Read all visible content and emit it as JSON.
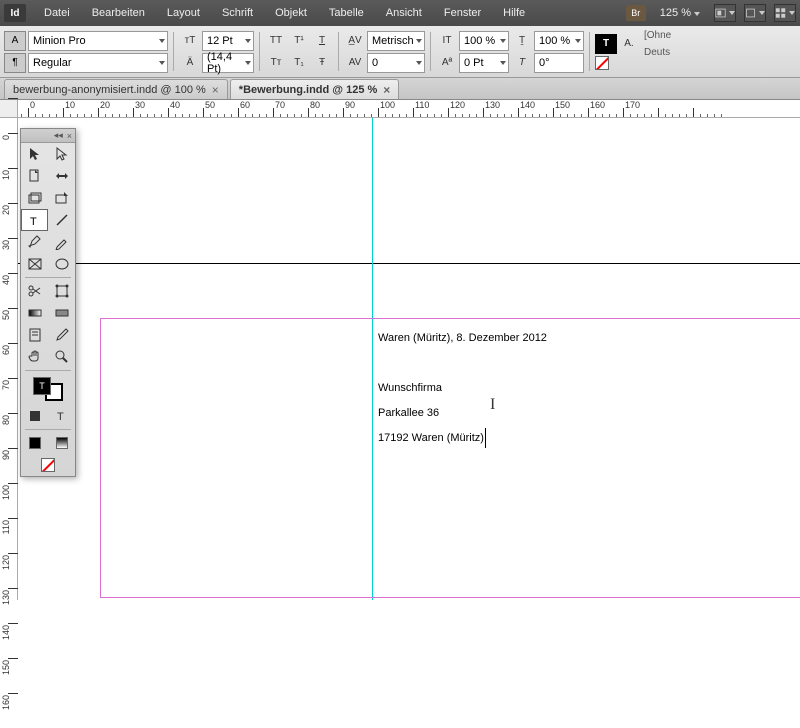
{
  "app_icon": "Id",
  "menu": [
    "Datei",
    "Bearbeiten",
    "Layout",
    "Schrift",
    "Objekt",
    "Tabelle",
    "Ansicht",
    "Fenster",
    "Hilfe"
  ],
  "br_icon": "Br",
  "zoom": "125 %",
  "control": {
    "para_icon": "A",
    "font": "Minion Pro",
    "style": "Regular",
    "size_icon": "T",
    "size": "12 Pt",
    "leading_icon": "A",
    "leading": "(14,4 Pt)",
    "caps": [
      "TT",
      "T¹",
      "T"
    ],
    "caps2": [
      "Tт",
      "T₁",
      "Ŧ"
    ],
    "kern_icon": "AV",
    "kern_mode": "Metrisch",
    "track_icon": "AV",
    "track": "0",
    "vscale_icon": "IT",
    "vscale": "100 %",
    "hscale_icon": "T",
    "hscale": "100 %",
    "baseline_icon": "Aª",
    "baseline": "0 Pt",
    "skew_icon": "T",
    "skew": "0°",
    "fill_icon": "T",
    "lang_icon": "A.",
    "ohne": "[Ohne",
    "lang": "Deuts"
  },
  "tabs": [
    {
      "label": "bewerbung-anonymisiert.indd @ 100 %",
      "active": false
    },
    {
      "label": "*Bewerbung.indd @ 125 %",
      "active": true
    }
  ],
  "ruler_h": [
    "0",
    "10",
    "20",
    "30",
    "40",
    "50",
    "60",
    "70",
    "80",
    "90",
    "100",
    "110",
    "120",
    "130",
    "140",
    "150"
  ],
  "ruler_v": [
    "0",
    "10",
    "20",
    "30"
  ],
  "document": {
    "line1": "Waren (Müritz), 8. Dezember 2012",
    "line2": "Wunschfirma",
    "line3": "Parkallee 36",
    "line4": "17192 Waren (Müritz)"
  },
  "right_labels": [
    "[Ohne",
    "Deuts"
  ]
}
